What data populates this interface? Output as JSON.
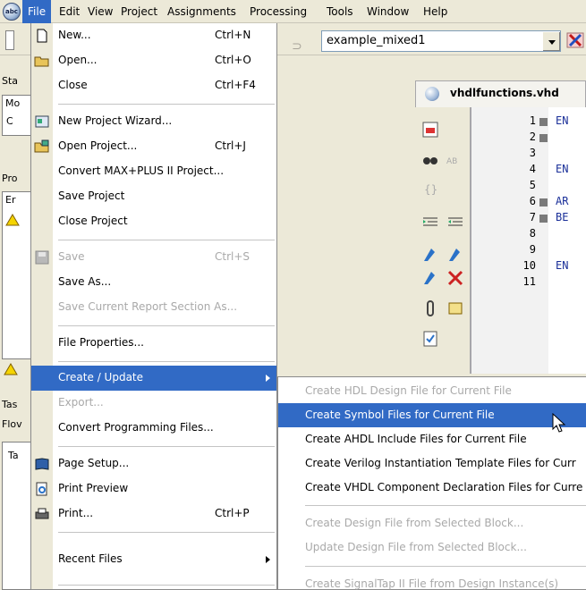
{
  "menubar": {
    "app_icon_text": "abc",
    "items": [
      "File",
      "Edit",
      "View",
      "Project",
      "Assignments",
      "Processing",
      "Tools",
      "Window",
      "Help"
    ]
  },
  "toolbar": {
    "project_combo_value": "example_mixed1"
  },
  "left_panels": {
    "top_title": "Sta",
    "top_col": "Mo",
    "top_cell": "C",
    "mid_title": "Pro",
    "mid_col": "Er",
    "tasks_title": "Tas",
    "flow_label": "Flov",
    "tasks_col": "Ta"
  },
  "editor": {
    "tab_title": "vhdlfunctions.vhd",
    "lines": [
      {
        "n": "1",
        "fold": true,
        "code": "EN"
      },
      {
        "n": "2",
        "fold": true,
        "code": ""
      },
      {
        "n": "3",
        "fold": false,
        "code": ""
      },
      {
        "n": "4",
        "fold": false,
        "code": "EN"
      },
      {
        "n": "5",
        "fold": false,
        "code": ""
      },
      {
        "n": "6",
        "fold": true,
        "code": "AR"
      },
      {
        "n": "7",
        "fold": true,
        "code": "BE"
      },
      {
        "n": "8",
        "fold": false,
        "code": ""
      },
      {
        "n": "9",
        "fold": false,
        "code": ""
      },
      {
        "n": "10",
        "fold": false,
        "code": "EN"
      },
      {
        "n": "11",
        "fold": false,
        "code": ""
      }
    ]
  },
  "file_menu": {
    "new": {
      "label": "New...",
      "shortcut": "Ctrl+N"
    },
    "open": {
      "label": "Open...",
      "shortcut": "Ctrl+O"
    },
    "close": {
      "label": "Close",
      "shortcut": "Ctrl+F4"
    },
    "new_project_wizard": {
      "label": "New Project Wizard..."
    },
    "open_project": {
      "label": "Open Project...",
      "shortcut": "Ctrl+J"
    },
    "convert_maxplus": {
      "label": "Convert MAX+PLUS II Project..."
    },
    "save_project": {
      "label": "Save Project"
    },
    "close_project": {
      "label": "Close Project"
    },
    "save": {
      "label": "Save",
      "shortcut": "Ctrl+S"
    },
    "save_as": {
      "label": "Save As..."
    },
    "save_report": {
      "label": "Save Current Report Section As..."
    },
    "file_properties": {
      "label": "File Properties..."
    },
    "create_update": {
      "label": "Create / Update"
    },
    "export": {
      "label": "Export..."
    },
    "convert_programming": {
      "label": "Convert Programming Files..."
    },
    "page_setup": {
      "label": "Page Setup..."
    },
    "print_preview": {
      "label": "Print Preview"
    },
    "print": {
      "label": "Print...",
      "shortcut": "Ctrl+P"
    },
    "recent_files": {
      "label": "Recent Files"
    }
  },
  "create_submenu": {
    "items": [
      {
        "label": "Create HDL Design File for Current File",
        "enabled": false
      },
      {
        "label": "Create Symbol Files for Current File",
        "enabled": true,
        "selected": true
      },
      {
        "label": "Create AHDL Include Files for Current File",
        "enabled": true
      },
      {
        "label": "Create Verilog Instantiation Template Files for Curr",
        "enabled": true
      },
      {
        "label": "Create VHDL Component Declaration Files for Curre",
        "enabled": true
      },
      {
        "label": "Create Design File from Selected Block...",
        "enabled": false
      },
      {
        "label": "Update Design File from Selected Block...",
        "enabled": false
      },
      {
        "label": "Create SignalTap II File from Design Instance(s)",
        "enabled": false
      }
    ]
  },
  "colors": {
    "highlight": "#316ac5",
    "menu_bg": "#ffffff",
    "chrome": "#ece9d8",
    "disabled_text": "#a9a9a9"
  }
}
